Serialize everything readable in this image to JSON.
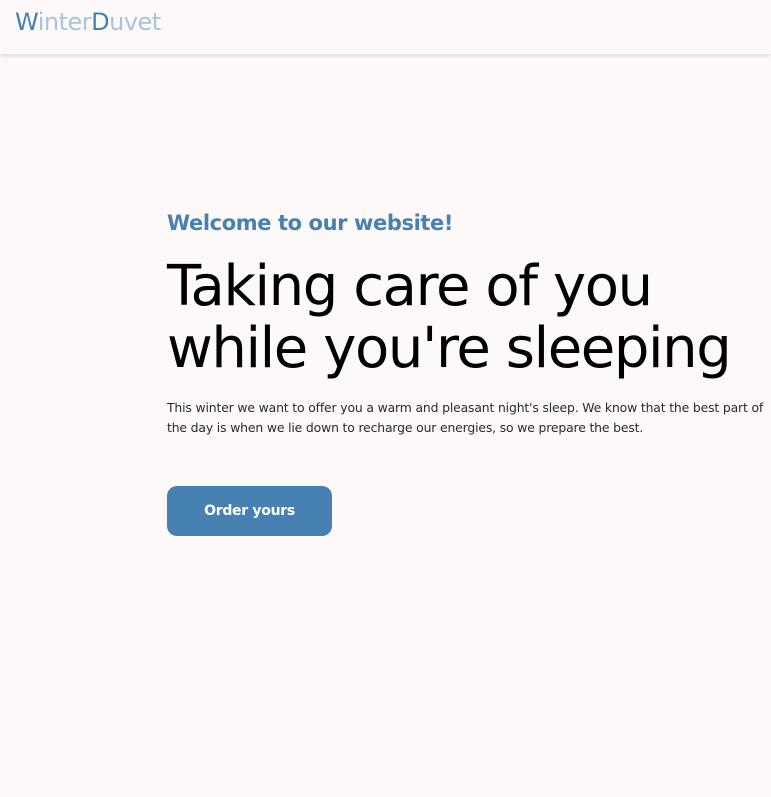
{
  "header": {
    "logo": {
      "winter_initial": "W",
      "winter_rest": "inter",
      "duvet_initial": "D",
      "duvet_rest": "uvet"
    }
  },
  "hero": {
    "subtitle": "Welcome to our website!",
    "headline_line1": "Taking care of you",
    "headline_line2": "while you're sleeping",
    "description": "This winter we want to offer you a warm and pleasant night's sleep. We know that the best part of the day is when we lie down to recharge our energies, so we prepare the best.",
    "cta_label": "Order yours"
  },
  "colors": {
    "background": "#fdf9f8",
    "brand_primary": "#4781b1",
    "brand_light": "#a9c3dc",
    "text": "#000000"
  }
}
